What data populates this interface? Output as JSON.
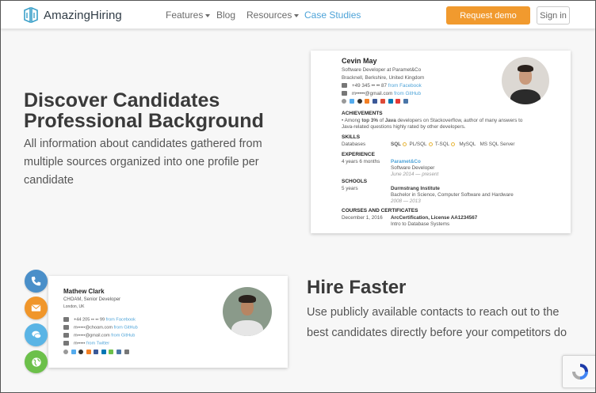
{
  "nav": {
    "logo_text": "AmazingHiring",
    "links": [
      {
        "label": "Features",
        "dropdown": true
      },
      {
        "label": "Blog",
        "dropdown": false
      },
      {
        "label": "Resources",
        "dropdown": true
      },
      {
        "label": "Case Studies",
        "dropdown": false
      }
    ],
    "request_demo": "Request demo",
    "sign_in": "Sign in"
  },
  "colors": {
    "accent_orange": "#f19a2e",
    "link_blue": "#4da3d8",
    "phone": "#4a8fc9",
    "email": "#f0962b",
    "chat": "#5ab4e5",
    "globe": "#6cc04a"
  },
  "section1": {
    "title": "Discover Candidates Professional Background",
    "text": "All information about candidates gathered from multiple sources organized into one profile per candidate"
  },
  "profile_big": {
    "name": "Cevin May",
    "role": "Software Developer at Paramet&Co",
    "location": "Bracknell, Berkshire, United Kingdom",
    "phone": "+49 345 •• •• 87",
    "phone_source": "from Facebook",
    "email": "m•••••@gmail.com",
    "email_source": "from GitHub",
    "achievements_title": "ACHIEVEMENTS",
    "achievement_line1_pre": "• Among ",
    "achievement_line1_bold1": "top 3%",
    "achievement_line1_mid": " of ",
    "achievement_line1_bold2": "Java",
    "achievement_line1_post": " developers on Stackoverflow, author of many answers to",
    "achievement_line2": "Java-related questions highly rated by other developers.",
    "skills_title": "SKILLS",
    "skills_label": "Databases",
    "skills": [
      "SQL",
      "PL/SQL",
      "T-SQL",
      "MySQL",
      "MS SQL Server"
    ],
    "experience_title": "EXPERIENCE",
    "experience_duration": "4 years 6 months",
    "experience_company": "Paramet&Co",
    "experience_role": "Software Developer",
    "experience_dates": "June 2014 — present",
    "schools_title": "SCHOOLS",
    "schools_duration": "5 years",
    "school_name": "Durmstrang Institute",
    "school_degree": "Bachelor in Science, Computer Software and Hardware",
    "school_dates": "2008 — 2013",
    "courses_title": "COURSES AND CERTIFICATES",
    "course_date": "December 1, 2016",
    "course_name": "ArcCertification, License AA1234567",
    "course_desc": "Intro to Database Systems"
  },
  "section2": {
    "title": "Hire Faster",
    "text": "Use publicly available contacts to reach out to the best candidates directly before your competitors do"
  },
  "profile_small": {
    "name": "Mathew Clark",
    "role": "CHOAM, Senior Developer",
    "location": "London, UK",
    "phone": "+44 205 •• •• 99",
    "phone_source": "from Facebook",
    "email1": "m•••••@choam.com",
    "email1_source": "from GitHub",
    "email2": "m•••••@gmail.com",
    "email2_source": "from GitHub",
    "other": "m•••••",
    "other_source": "from Twitter"
  },
  "contact_buttons": [
    {
      "icon": "phone-icon"
    },
    {
      "icon": "email-icon"
    },
    {
      "icon": "chat-icon"
    },
    {
      "icon": "globe-icon"
    }
  ]
}
